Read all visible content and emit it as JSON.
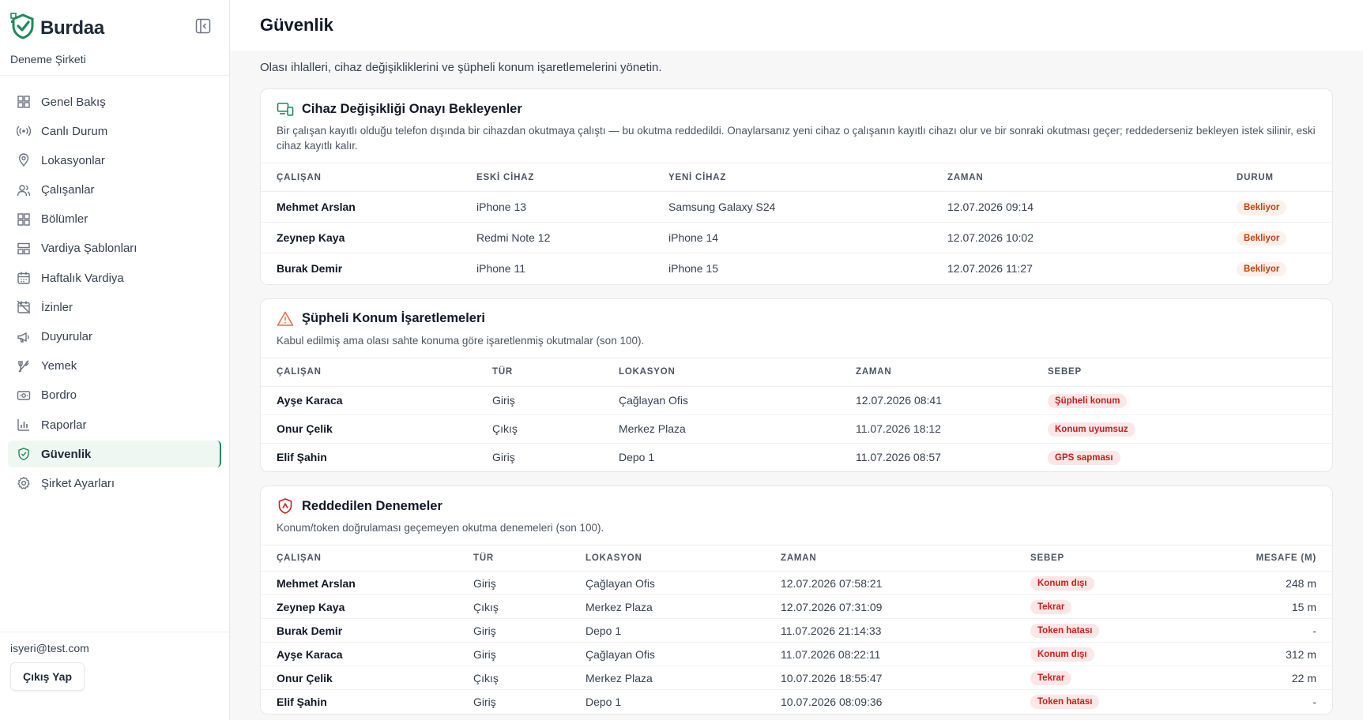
{
  "brand": {
    "name": "Burdaa",
    "company": "Deneme Şirketi"
  },
  "nav": [
    {
      "label": "Genel Bakış",
      "icon": "grid-icon"
    },
    {
      "label": "Canlı Durum",
      "icon": "broadcast-icon"
    },
    {
      "label": "Lokasyonlar",
      "icon": "map-pin-icon"
    },
    {
      "label": "Çalışanlar",
      "icon": "users-icon"
    },
    {
      "label": "Bölümler",
      "icon": "grid-icon"
    },
    {
      "label": "Vardiya Şablonları",
      "icon": "layout-icon"
    },
    {
      "label": "Haftalık Vardiya",
      "icon": "calendar-icon"
    },
    {
      "label": "İzinler",
      "icon": "calendar-off-icon"
    },
    {
      "label": "Duyurular",
      "icon": "megaphone-icon"
    },
    {
      "label": "Yemek",
      "icon": "utensils-icon"
    },
    {
      "label": "Bordro",
      "icon": "money-icon"
    },
    {
      "label": "Raporlar",
      "icon": "bar-chart-icon"
    },
    {
      "label": "Güvenlik",
      "icon": "shield-icon",
      "active": true
    },
    {
      "label": "Şirket Ayarları",
      "icon": "gear-icon"
    }
  ],
  "footer": {
    "email": "isyeri@test.com",
    "logout": "Çıkış Yap"
  },
  "page": {
    "title": "Güvenlik",
    "subtitle": "Olası ihlalleri, cihaz değişikliklerini ve şüpheli konum işaretlemelerini yönetin."
  },
  "device_changes": {
    "title": "Cihaz Değişikliği Onayı Bekleyenler",
    "description": "Bir çalışan kayıtlı olduğu telefon dışında bir cihazdan okutmaya çalıştı — bu okutma reddedildi. Onaylarsanız yeni cihaz o çalışanın kayıtlı cihazı olur ve bir sonraki okutması geçer; reddederseniz bekleyen istek silinir, eski cihaz kayıtlı kalır.",
    "columns": [
      "ÇALIŞAN",
      "ESKİ CİHAZ",
      "YENİ CİHAZ",
      "ZAMAN",
      "DURUM"
    ],
    "rows": [
      {
        "employee": "Mehmet Arslan",
        "old": "iPhone 13",
        "new": "Samsung Galaxy S24",
        "time": "12.07.2026 09:14",
        "status": "Bekliyor"
      },
      {
        "employee": "Zeynep Kaya",
        "old": "Redmi Note 12",
        "new": "iPhone 14",
        "time": "12.07.2026 10:02",
        "status": "Bekliyor"
      },
      {
        "employee": "Burak Demir",
        "old": "iPhone 11",
        "new": "iPhone 15",
        "time": "12.07.2026 11:27",
        "status": "Bekliyor"
      }
    ]
  },
  "suspicious": {
    "title": "Şüpheli Konum İşaretlemeleri",
    "description": "Kabul edilmiş ama olası sahte konuma göre işaretlenmiş okutmalar (son 100).",
    "columns": [
      "ÇALIŞAN",
      "TÜR",
      "LOKASYON",
      "ZAMAN",
      "SEBEP"
    ],
    "rows": [
      {
        "employee": "Ayşe Karaca",
        "type": "Giriş",
        "location": "Çağlayan Ofis",
        "time": "12.07.2026 08:41",
        "reason": "Şüpheli konum"
      },
      {
        "employee": "Onur Çelik",
        "type": "Çıkış",
        "location": "Merkez Plaza",
        "time": "11.07.2026 18:12",
        "reason": "Konum uyumsuz"
      },
      {
        "employee": "Elif Şahin",
        "type": "Giriş",
        "location": "Depo 1",
        "time": "11.07.2026 08:57",
        "reason": "GPS sapması"
      }
    ]
  },
  "rejected": {
    "title": "Reddedilen Denemeler",
    "description": "Konum/token doğrulaması geçemeyen okutma denemeleri (son 100).",
    "columns": [
      "ÇALIŞAN",
      "TÜR",
      "LOKASYON",
      "ZAMAN",
      "SEBEP",
      "MESAFE (M)"
    ],
    "rows": [
      {
        "employee": "Mehmet Arslan",
        "type": "Giriş",
        "location": "Çağlayan Ofis",
        "time": "12.07.2026 07:58:21",
        "reason": "Konum dışı",
        "distance": "248 m"
      },
      {
        "employee": "Zeynep Kaya",
        "type": "Çıkış",
        "location": "Merkez Plaza",
        "time": "12.07.2026 07:31:09",
        "reason": "Tekrar",
        "distance": "15 m"
      },
      {
        "employee": "Burak Demir",
        "type": "Giriş",
        "location": "Depo 1",
        "time": "11.07.2026 21:14:33",
        "reason": "Token hatası",
        "distance": "-"
      },
      {
        "employee": "Ayşe Karaca",
        "type": "Giriş",
        "location": "Çağlayan Ofis",
        "time": "11.07.2026 08:22:11",
        "reason": "Konum dışı",
        "distance": "312 m"
      },
      {
        "employee": "Onur Çelik",
        "type": "Çıkış",
        "location": "Merkez Plaza",
        "time": "10.07.2026 18:55:47",
        "reason": "Tekrar",
        "distance": "22 m"
      },
      {
        "employee": "Elif Şahin",
        "type": "Giriş",
        "location": "Depo 1",
        "time": "10.07.2026 08:09:36",
        "reason": "Token hatası",
        "distance": "-"
      }
    ]
  },
  "colors": {
    "accent": "#1f8a5b",
    "pending": "#c2410c",
    "alert": "#c81e1e",
    "warning_icon": "#e2704a"
  }
}
